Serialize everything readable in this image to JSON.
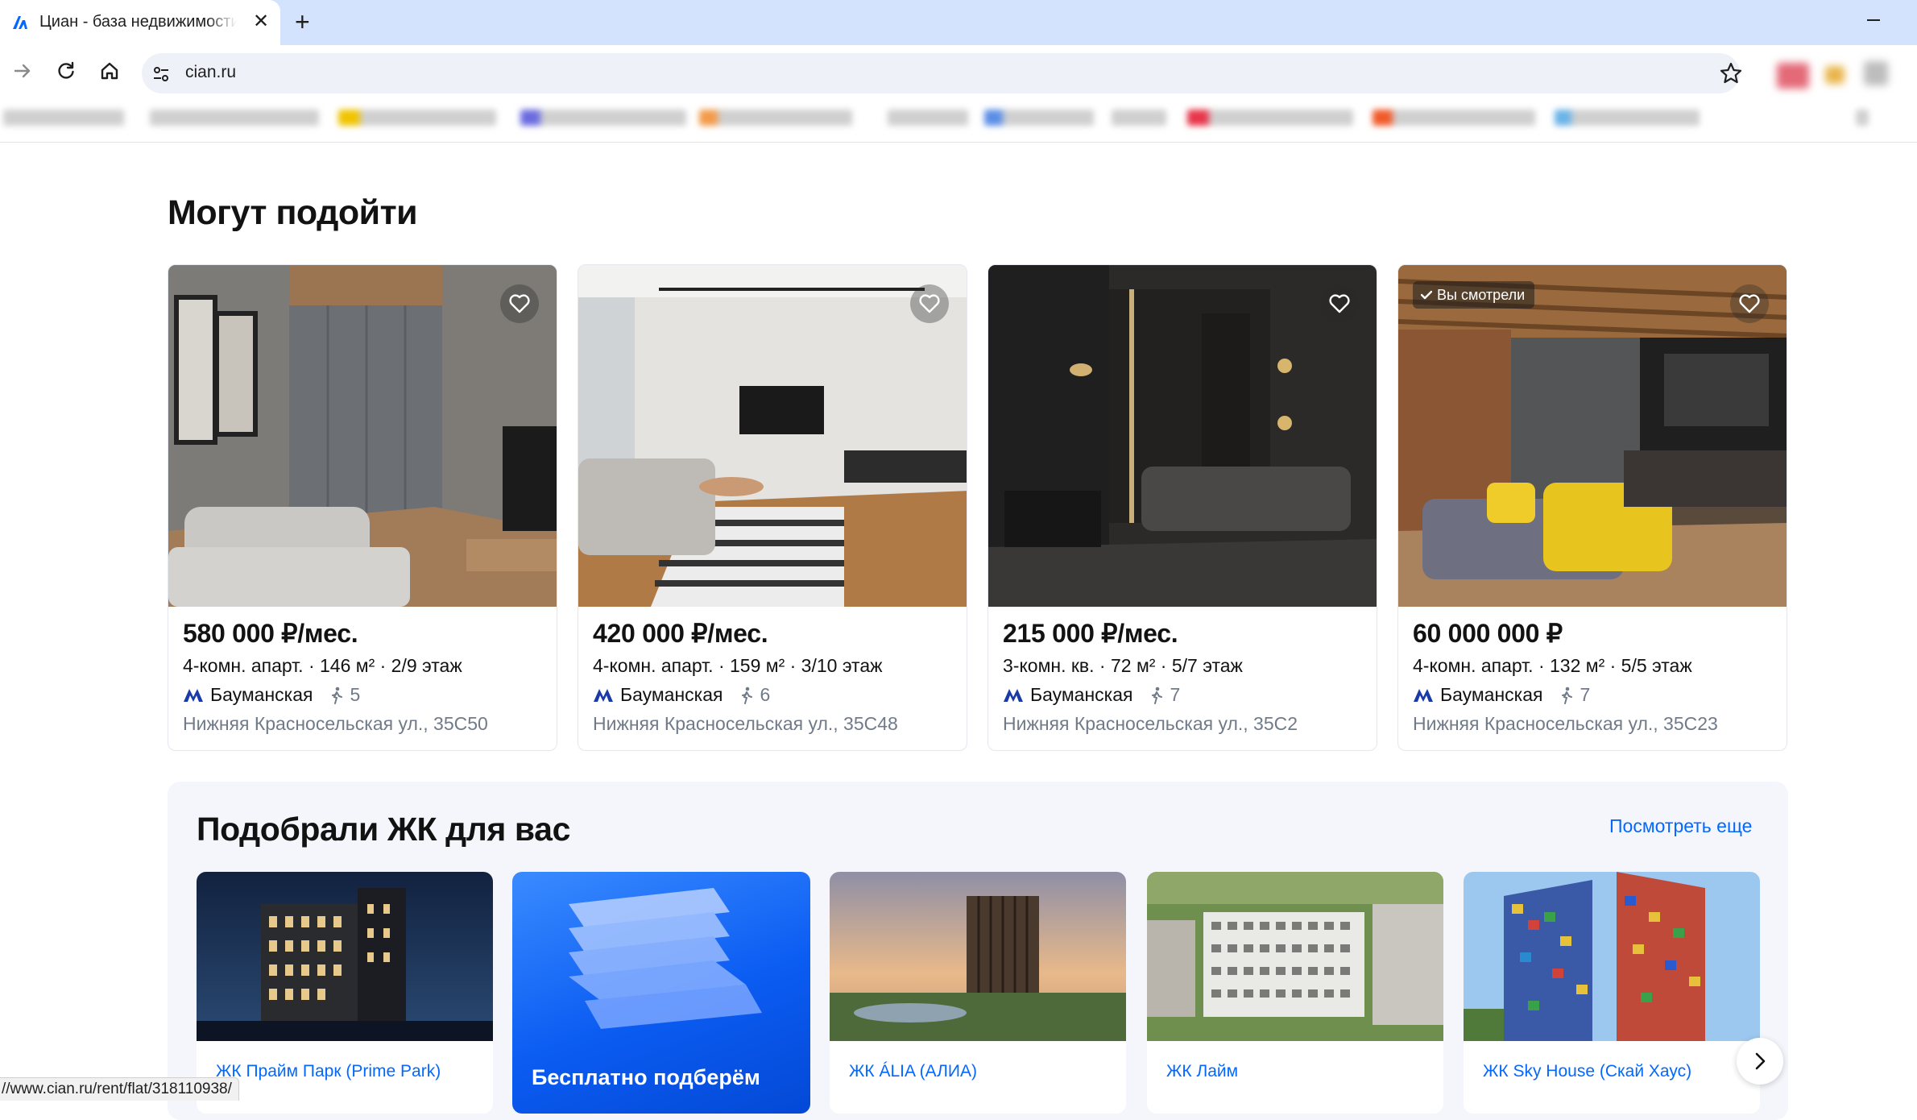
{
  "browser": {
    "tab_title": "Циан - база недвижимости",
    "url": "cian.ru",
    "status_url": "//www.cian.ru/rent/flat/318110938/"
  },
  "icons": {
    "tab_favicon": "cian-logo-icon",
    "tab_close": "close-icon",
    "new_tab": "plus-icon",
    "forward": "arrow-right-icon",
    "reload": "reload-icon",
    "home": "home-icon",
    "site_info": "tune-icon",
    "bookmark": "star-icon",
    "favorite": "heart-icon",
    "metro": "metro-icon",
    "walk": "walk-icon",
    "next": "chevron-right-icon"
  },
  "colors": {
    "accent": "#0468ff",
    "text": "#121212",
    "muted": "#707a89"
  },
  "recommend": {
    "title": "Могут подойти",
    "cards": [
      {
        "price": "580 000 ₽/мес.",
        "params": "4-комн. апарт. · 146 м² · 2/9 этаж",
        "metro": "Бауманская",
        "walk": "5",
        "address": "Нижняя Красносельская ул., 35С50",
        "badge": ""
      },
      {
        "price": "420 000 ₽/мес.",
        "params": "4-комн. апарт. · 159 м² · 3/10 этаж",
        "metro": "Бауманская",
        "walk": "6",
        "address": "Нижняя Красносельская ул., 35С48",
        "badge": ""
      },
      {
        "price": "215 000 ₽/мес.",
        "params": "3-комн. кв. · 72 м² · 5/7 этаж",
        "metro": "Бауманская",
        "walk": "7",
        "address": "Нижняя Красносельская ул., 35С2",
        "badge": ""
      },
      {
        "price": "60 000 000 ₽",
        "params": "4-комн. апарт. · 132 м² · 5/5 этаж",
        "metro": "Бауманская",
        "walk": "7",
        "address": "Нижняя Красносельская ул., 35С23",
        "badge": "Вы смотрели"
      }
    ]
  },
  "jk": {
    "title": "Подобрали ЖК для вас",
    "see_more": "Посмотреть еще",
    "promo_title": "Бесплатно подберём",
    "cards": [
      {
        "name": "ЖК Прайм Парк (Prime Park)"
      },
      {
        "name": "ЖК ÁLIA (АЛИА)"
      },
      {
        "name": "ЖК Лайм"
      },
      {
        "name": "ЖК Sky House (Скай Хаус)"
      }
    ]
  }
}
